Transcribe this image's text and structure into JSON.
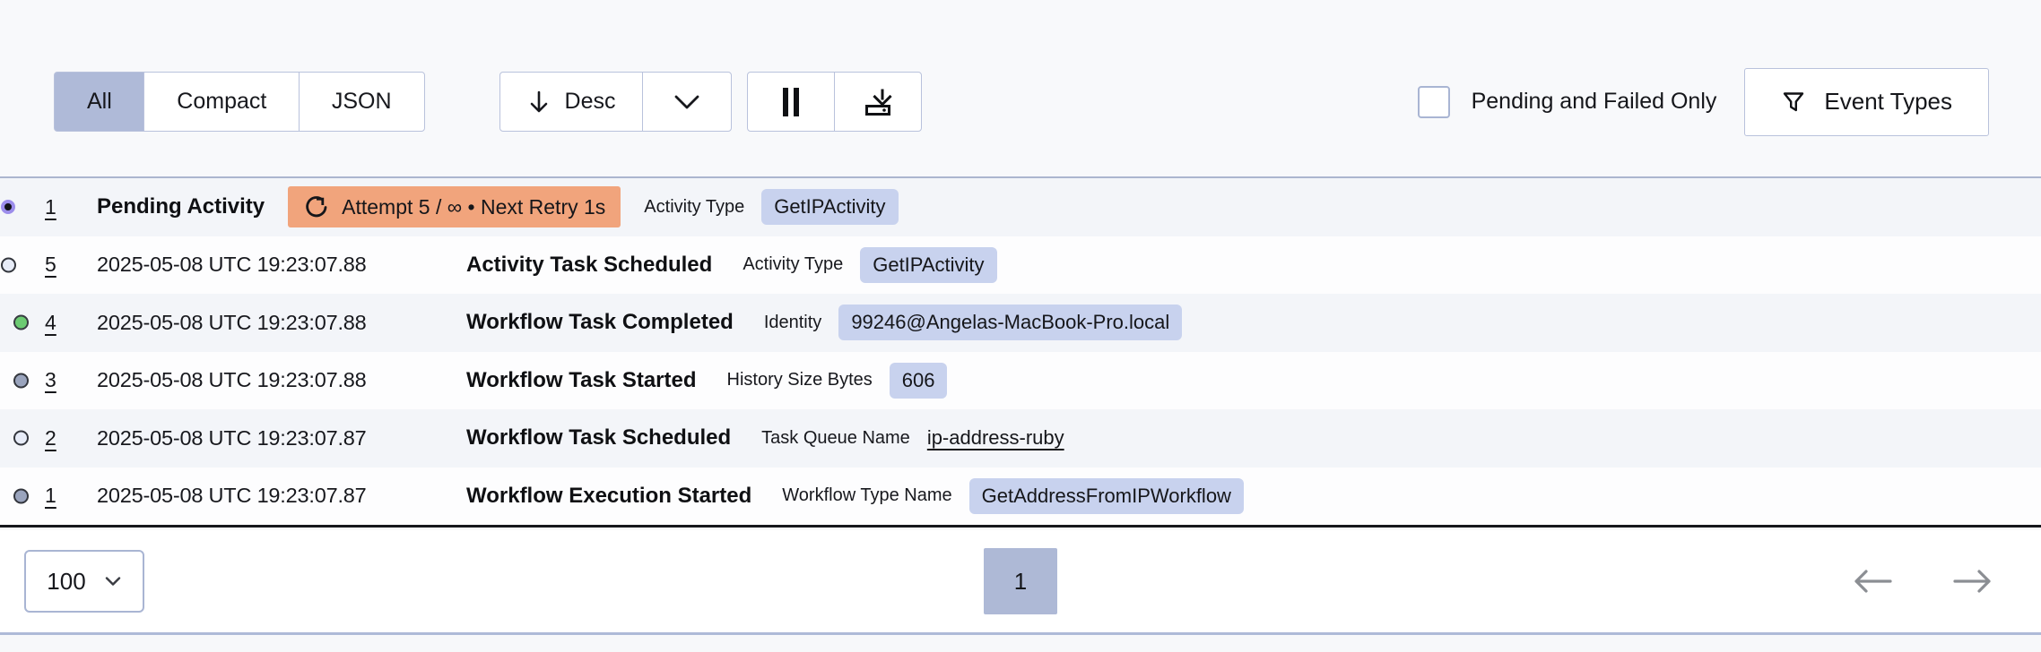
{
  "colors": {
    "page_bg": "#F8F9FB",
    "accent_indigo_line": "#4B50D0",
    "pending_orange": "#F1A47C",
    "dashed_orange": "#EFA97F",
    "badge_lavender": "#C8D2EE",
    "selected_lavender": "#AFBAD8",
    "marker_green": "#6CCB72",
    "marker_gray": "#9AA4BD",
    "marker_light": "#E7ECF8",
    "marker_pending_ring": "#9C8DEB",
    "border_gray_blue": "#B9C2DC",
    "table_bottom_border": "#16171B"
  },
  "toolbar": {
    "tabs": [
      {
        "label": "All",
        "selected": true
      },
      {
        "label": "Compact",
        "selected": false
      },
      {
        "label": "JSON",
        "selected": false
      }
    ],
    "sort_label": "Desc",
    "icons": {
      "sort": "arrow-down-icon",
      "sort_menu": "chevron-down-icon",
      "pause": "pause-icon",
      "download": "download-icon",
      "filter": "funnel-icon"
    },
    "pending_failed_label": "Pending and Failed Only",
    "pending_failed_checked": false,
    "event_types_label": "Event Types"
  },
  "events": [
    {
      "id": "1",
      "time": "",
      "name": "Pending Activity",
      "marker": "pending",
      "on_dashed": true,
      "retry": "Attempt 5 / ∞ • Next Retry 1s",
      "attr_label": "Activity Type",
      "attr_value": "GetIPActivity",
      "attr_kind": "badge"
    },
    {
      "id": "5",
      "time": "2025-05-08 UTC 19:23:07.88",
      "name": "Activity Task Scheduled",
      "marker": "light",
      "on_dashed": true,
      "attr_label": "Activity Type",
      "attr_value": "GetIPActivity",
      "attr_kind": "badge"
    },
    {
      "id": "4",
      "time": "2025-05-08 UTC 19:23:07.88",
      "name": "Workflow Task Completed",
      "marker": "green",
      "on_dashed": false,
      "attr_label": "Identity",
      "attr_value": "99246@Angelas-MacBook-Pro.local",
      "attr_kind": "badge"
    },
    {
      "id": "3",
      "time": "2025-05-08 UTC 19:23:07.88",
      "name": "Workflow Task Started",
      "marker": "gray",
      "on_dashed": false,
      "attr_label": "History Size Bytes",
      "attr_value": "606",
      "attr_kind": "badge"
    },
    {
      "id": "2",
      "time": "2025-05-08 UTC 19:23:07.87",
      "name": "Workflow Task Scheduled",
      "marker": "light",
      "on_dashed": false,
      "attr_label": "Task Queue Name",
      "attr_value": "ip-address-ruby",
      "attr_kind": "link"
    },
    {
      "id": "1",
      "time": "2025-05-08 UTC 19:23:07.87",
      "name": "Workflow Execution Started",
      "marker": "gray",
      "on_dashed": false,
      "attr_label": "Workflow Type Name",
      "attr_value": "GetAddressFromIPWorkflow",
      "attr_kind": "badge"
    }
  ],
  "pagination": {
    "page_size": "100",
    "current_page": "1"
  }
}
